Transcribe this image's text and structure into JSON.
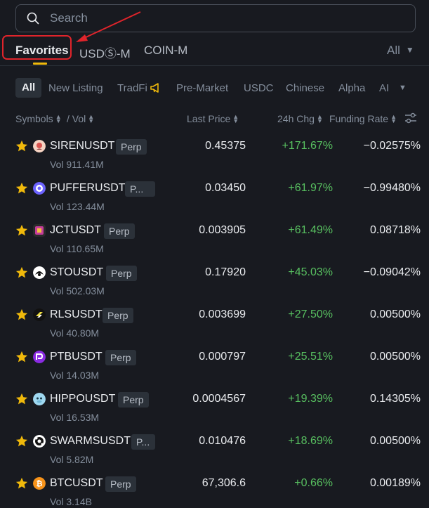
{
  "search": {
    "placeholder": "Search"
  },
  "tabs": {
    "favorites": "Favorites",
    "usds_m": "USDⓈ-M",
    "coin_m": "COIN-M",
    "all_dropdown": "All"
  },
  "filters": [
    "All",
    "New Listing",
    "TradFi",
    "Pre-Market",
    "USDC",
    "Chinese",
    "Alpha",
    "AI"
  ],
  "headers": {
    "symbols": "Symbols",
    "vol": "/ Vol",
    "last_price": "Last Price",
    "chg": "24h Chg",
    "funding_rate": "Funding Rate"
  },
  "colors": {
    "accent": "#f0b90b",
    "up": "#58c060",
    "highlight": "#e0242b",
    "bg": "#181a20"
  },
  "rows": [
    {
      "symbol": "SIRENUSDT",
      "tag": "Perp",
      "vol": "Vol 911.41M",
      "price": "0.45375",
      "change": "+171.67%",
      "funding": "−0.02575%",
      "icon": "siren-icon",
      "icon_color": "#f6d3c3"
    },
    {
      "symbol": "PUFFERUSDT",
      "tag": "P...",
      "vol": "Vol 123.44M",
      "price": "0.03450",
      "change": "+61.97%",
      "funding": "−0.99480%",
      "icon": "puffer-icon",
      "icon_color": "#6c63ff"
    },
    {
      "symbol": "JCTUSDT",
      "tag": "Perp",
      "vol": "Vol 110.65M",
      "price": "0.003905",
      "change": "+61.49%",
      "funding": "0.08718%",
      "icon": "jct-icon",
      "icon_color": "#c43d9a"
    },
    {
      "symbol": "STOUSDT",
      "tag": "Perp",
      "vol": "Vol 502.03M",
      "price": "0.17920",
      "change": "+45.03%",
      "funding": "−0.09042%",
      "icon": "sto-icon",
      "icon_color": "#ffffff"
    },
    {
      "symbol": "RLSUSDT",
      "tag": "Perp",
      "vol": "Vol 40.80M",
      "price": "0.003699",
      "change": "+27.50%",
      "funding": "0.00500%",
      "icon": "rls-icon",
      "icon_color": "#111111"
    },
    {
      "symbol": "PTBUSDT",
      "tag": "Perp",
      "vol": "Vol 14.03M",
      "price": "0.000797",
      "change": "+25.51%",
      "funding": "0.00500%",
      "icon": "ptb-icon",
      "icon_color": "#8a2be2"
    },
    {
      "symbol": "HIPPOUSDT",
      "tag": "Perp",
      "vol": "Vol 16.53M",
      "price": "0.0004567",
      "change": "+19.39%",
      "funding": "0.14305%",
      "icon": "hippo-icon",
      "icon_color": "#9fd8f0"
    },
    {
      "symbol": "SWARMSUSDT",
      "tag": "P...",
      "vol": "Vol 5.82M",
      "price": "0.010476",
      "change": "+18.69%",
      "funding": "0.00500%",
      "icon": "swarms-icon",
      "icon_color": "#ffffff"
    },
    {
      "symbol": "BTCUSDT",
      "tag": "Perp",
      "vol": "Vol 3.14B",
      "price": "67,306.6",
      "change": "+0.66%",
      "funding": "0.00189%",
      "icon": "bitcoin-icon",
      "icon_color": "#f7931a"
    }
  ]
}
